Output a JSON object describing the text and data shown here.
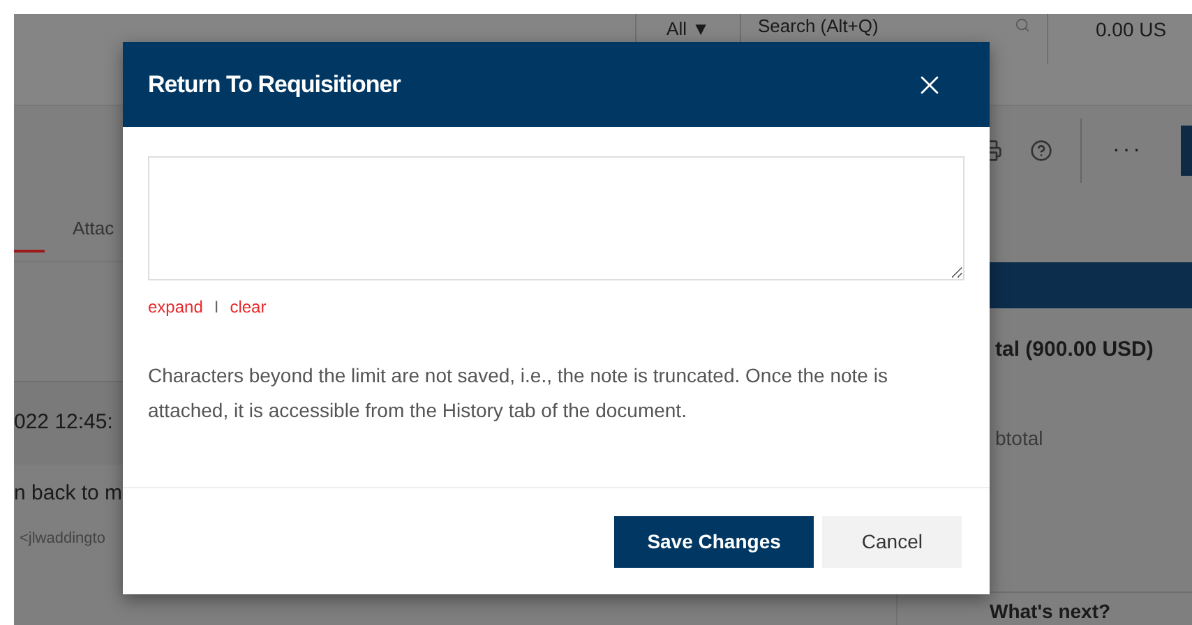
{
  "background": {
    "scope_filter": "All ▼",
    "search": {
      "placeholder": "Search (Alt+Q)"
    },
    "cart_total": "0.00 US",
    "more_menu": "···",
    "tab_partial": "Attac",
    "timestamp": "022 12:45:",
    "comment": "n back to m",
    "comment_author": "<jlwaddingto",
    "total": "tal (900.00 USD)",
    "subtotal": "btotal",
    "whats_next": "What's next?"
  },
  "dialog": {
    "title": "Return To Requisitioner",
    "links": [
      "expand",
      "clear"
    ],
    "separator": "I",
    "message": "Characters beyond the limit are not saved, i.e., the note is truncated. Once the note is attached, it is accessible from the History tab of the document.",
    "buttons": [
      {
        "label": "Save Changes",
        "kind": "primary"
      },
      {
        "label": "Cancel",
        "kind": "secondary"
      }
    ]
  }
}
